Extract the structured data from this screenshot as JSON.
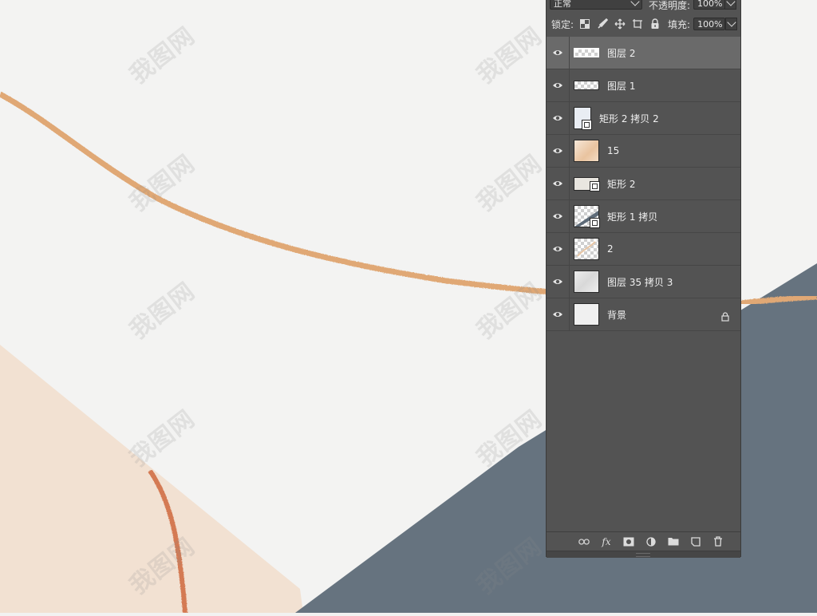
{
  "canvas": {
    "colors": {
      "marble_white": "#f3f3f2",
      "slate": "#66737f",
      "vein": "#e0a875",
      "rose_marble": "#f3e0d0",
      "copper_vein": "#d47a52"
    },
    "watermark_text": "我图网"
  },
  "panel": {
    "blend_mode": "正常",
    "opacity_label": "不透明度:",
    "opacity_value": "100%",
    "lock_label": "锁定:",
    "fill_label": "填充:",
    "fill_value": "100%",
    "layers": [
      {
        "name": "图层 2",
        "selected": true,
        "thumb": "transparent-wide"
      },
      {
        "name": "图层 1",
        "selected": false,
        "thumb": "transparent-wide"
      },
      {
        "name": "矩形 2 拷贝 2",
        "selected": false,
        "thumb": "shape-vertical"
      },
      {
        "name": "15",
        "selected": false,
        "thumb": "peach-marble"
      },
      {
        "name": "矩形 2",
        "selected": false,
        "thumb": "shape"
      },
      {
        "name": "矩形 1 拷贝",
        "selected": false,
        "thumb": "shape-diagonal"
      },
      {
        "name": "2",
        "selected": false,
        "thumb": "transparent"
      },
      {
        "name": "图层 35 拷贝 3",
        "selected": false,
        "thumb": "marble"
      },
      {
        "name": "背景",
        "selected": false,
        "thumb": "white",
        "locked": true
      }
    ],
    "bottom_icons": [
      "link-icon",
      "fx-icon",
      "mask-icon",
      "adjustment-icon",
      "folder-icon",
      "new-layer-icon",
      "trash-icon"
    ],
    "fx_label": "fx"
  }
}
